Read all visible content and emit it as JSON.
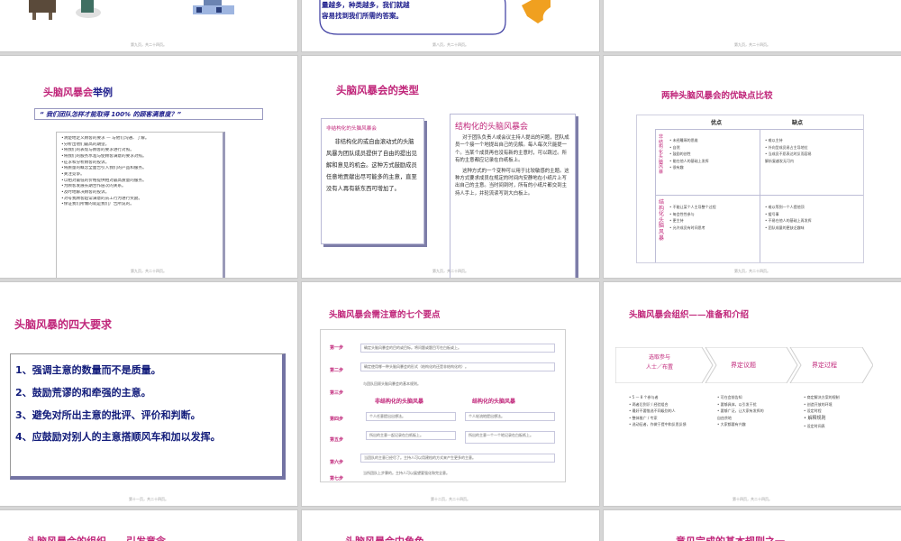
{
  "slides": {
    "s1": {
      "page": "第九页，共二十四页。"
    },
    "s2": {
      "page": "第八页，共二十四页。",
      "bubble": [
        "量越多，种类越多，我们就越",
        "容易找到我们所需的答案。"
      ]
    },
    "s3": {
      "page": "第九页，共二十四页。"
    },
    "s4": {
      "title_a": "头脑风暴会",
      "title_b": "举例",
      "quote": "“ 我们团队怎样才能取得 100% 的顾客满意度？”",
      "items": [
        "•清楚地定义顾客的要求  —  与他们沟通、了解。",
        "•分析出他们最高的期望。",
        "•将我们的表现与顾客的要求进行对照。",
        "•将我们的服务水准与使顾客满意的要求对照。",
        "•征求和分析顾客的投诉。",
        "•将质量的概念全面告引入我们的产品和服务。",
        "•关注竞争。",
        "•以相对最低的价格提供相对最高质量的服务。",
        "•为顾客发展长期合作层次的关系。",
        "•及时地解决顾客的投诉。",
        "•对号我顾客超常满意的员工行为进行奖励。",
        "•保证我们所做的就是我们广告所说的。"
      ],
      "page": "第九页，共二十四页。"
    },
    "s5": {
      "title": "头脑风暴会的类型",
      "left_title": "非结构化的头脑风暴会",
      "left_body": "非结构化的或自由滚动式的头脑风暴为团队成员提供了自由的提出见解和意见的机会。这种方式鼓励成员任意地贡献出尽可能多的主意，直至没有人再有新东西可增加了。",
      "right_title": "结构化的头脑风暴会",
      "right_body1": "对于团队负责人或会议主持人提出的问题，团队成员一个接一个地提出自己的见解。每人每次只能提一个。当某个成员再也没有新的主意时，可以跳过。所有的主意都应记录在白纸板上。",
      "right_body2": "这种方式的一个变种可以用于比较敏感的主题。这种方式要求成员在规定的时间内安静地在小纸片上写出自己的主意。当时间到时，所有的小纸片都交到主持人手上，并轮流读写到大白板上。",
      "page": "第九页，共二十四页。"
    },
    "s6": {
      "title": "两种头脑风暴会的优缺点比较",
      "col_pros": "优点",
      "col_cons": "缺点",
      "row1": "非结构化头脑风暴",
      "row2": "结构化头脑风暴",
      "r1_pros": [
        "• 未经雕琢的思维",
        "• 自然",
        "• 鼓励的创性",
        "• 能在他人的基础上发挥",
        "• 很有趣"
      ],
      "r1_cons": [
        "• 难以主持",
        "• 外向型成员易占主导地位",
        "• 当成员不愿表达时反而容易",
        "  解析复越发无可内"
      ],
      "r2_pros": [
        "• 不能让某个人主导整个过程",
        "• 每会性性参与",
        "• 更主持",
        "• 允许成员有时间思考"
      ],
      "r2_cons": [
        "• 难以等到一个人提他顶",
        "• 缓号事",
        "• 不易在他人的基础上再发挥",
        "• 团队成量的更缺乏趣味"
      ],
      "page": "第九页，共二十四页。"
    },
    "s7": {
      "title": "头脑风暴的四大要求",
      "items": [
        "1、强调主意的数量而不是质量。",
        "2、鼓励荒谬的和牵强的主意。",
        "3、避免对所出主意的批评、评价和判断。",
        "4、应鼓励对别人的主意搭顺风车和加以发挥。"
      ],
      "page": "第十一页，共二十四页。"
    },
    "s8": {
      "title": "头脑风暴会需注意的七个要点",
      "steps": [
        "第一步",
        "第二步",
        "第三步",
        "第四步",
        "第五步",
        "第六步",
        "第七步"
      ],
      "bar1": "确定头脑风暴会的目的或目标。将问题或题目写在白板或上。",
      "bar2": "确定使用哪一种头脑风暴会的形式（结构化的还是非结构化的）。",
      "bar3": "与团队回顾头脑风暴会的基本规则。",
      "sub_left": "非结构化的头脑风暴",
      "sub_right": "结构化的头脑风暴",
      "l1": "个人任意提出出想法。",
      "r1": "个人轮流地提出想法。",
      "l2": "所出的主意一起记录在白纸板上。",
      "r2": "所出的主意一个一个地记录在白板纸上。",
      "bar6": "当团队的主意已经尽了。主持人可以用建档的方式来产生更多的主意。",
      "bar7": "当所团队上步骤的。主持人可以展望要强化和完全意。",
      "page": "第十二页，共二十四页。"
    },
    "s9": {
      "title": "头脑风暴会组织——准备和介绍",
      "arrow1": [
        "选取参与",
        "人士／布置"
      ],
      "arrow2": "界定议题",
      "arrow3": "界定过程",
      "col1": [
        "• 5 — 8 个参与者",
        "• 两者后到识 / 经验组合",
        "• 最好不要惟选不同级别的人",
        "• 整体推广 / 专家",
        "• 选动征者，作做于提中和反思反馈"
      ],
      "col2": [
        "• 可在会前告知",
        "• 要够具体，以引发干扰",
        "• 要够广泛，让大家有发挥的",
        "  自由余地",
        "• 大家都要有兴趣"
      ],
      "col3": [
        "• 商定解决方案的规制",
        "• 创造开放的环境",
        "• 设定时程",
        "• 解释规则",
        "• 设定时间表"
      ],
      "page": "第十四页，共二十四页。"
    },
    "s10": {
      "title": "头脑风暴会的组织——引发意念"
    },
    "s11": {
      "title": "头脑风暴会中角色"
    },
    "s12": {
      "title": "意见完成的基本规则之一"
    }
  }
}
